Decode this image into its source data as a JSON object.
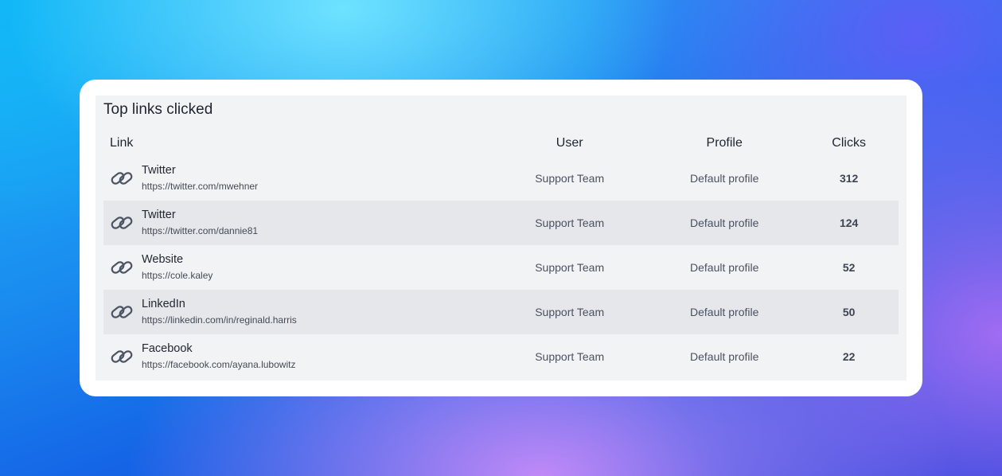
{
  "widget": {
    "title": "Top links clicked",
    "columns": {
      "link": "Link",
      "user": "User",
      "profile": "Profile",
      "clicks": "Clicks"
    },
    "rows": [
      {
        "name": "Twitter",
        "url": "https://twitter.com/mwehner",
        "user": "Support Team",
        "profile": "Default profile",
        "clicks": "312",
        "icon": "link-icon"
      },
      {
        "name": "Twitter",
        "url": "https://twitter.com/dannie81",
        "user": "Support Team",
        "profile": "Default profile",
        "clicks": "124",
        "icon": "link-icon"
      },
      {
        "name": "Website",
        "url": "https://cole.kaley",
        "user": "Support Team",
        "profile": "Default profile",
        "clicks": "52",
        "icon": "link-icon"
      },
      {
        "name": "LinkedIn",
        "url": "https://linkedin.com/in/reginald.harris",
        "user": "Support Team",
        "profile": "Default profile",
        "clicks": "50",
        "icon": "link-icon"
      },
      {
        "name": "Facebook",
        "url": "https://facebook.com/ayana.lubowitz",
        "user": "Support Team",
        "profile": "Default profile",
        "clicks": "22",
        "icon": "link-icon"
      }
    ]
  },
  "colors": {
    "card_bg": "#ffffff",
    "panel_bg": "#f2f3f5",
    "alt_row_bg": "#e5e7eb",
    "icon_stroke": "#4b5563"
  }
}
